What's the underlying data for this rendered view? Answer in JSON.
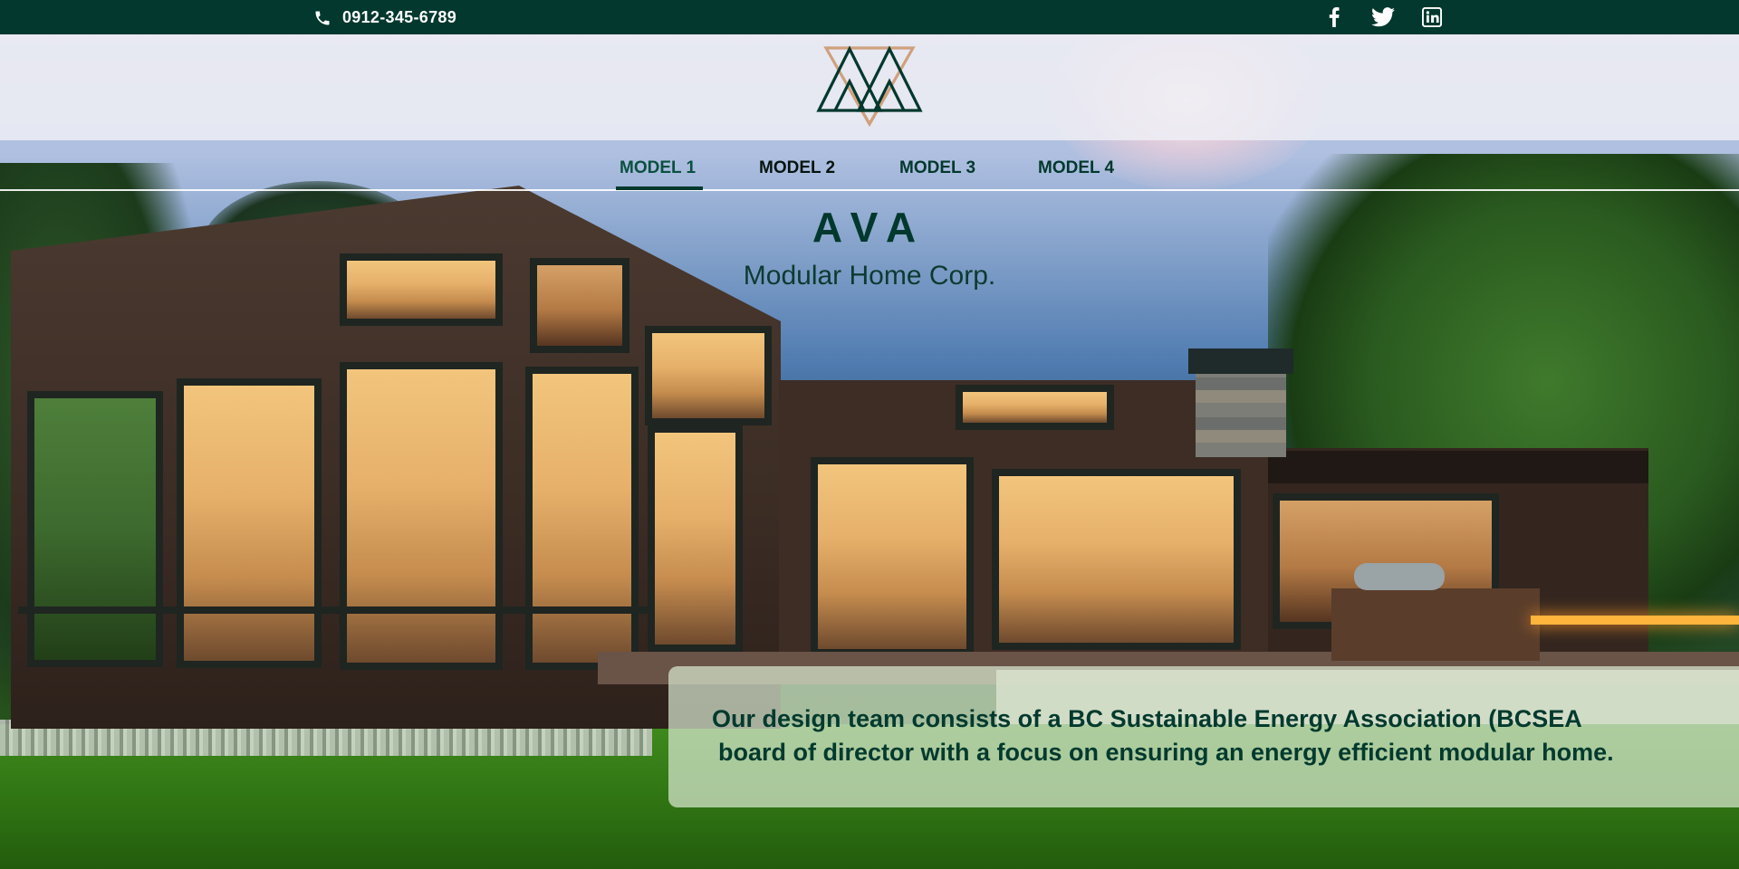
{
  "topbar": {
    "phone": "0912-345-6789",
    "icons": [
      "phone-icon",
      "facebook-icon",
      "twitter-icon",
      "linkedin-icon"
    ]
  },
  "logo": {
    "icon": "ava-triangle-logo",
    "colors": [
      "#02382d",
      "#d0a07c"
    ]
  },
  "nav": {
    "items": [
      {
        "label": "MODEL 1",
        "active": true
      },
      {
        "label": "MODEL 2",
        "active": false
      },
      {
        "label": "MODEL 3",
        "active": false
      },
      {
        "label": "MODEL 4",
        "active": false
      }
    ]
  },
  "brand": {
    "title": "AVA",
    "subtitle": "Modular Home Corp."
  },
  "info": {
    "line1": "Our design team consists of a BC Sustainable Energy Association (BCSEA",
    "line2": "board of director with a focus on ensuring an energy efficient modular home."
  },
  "colors": {
    "primary": "#02382d",
    "accent": "#d0a07c",
    "panel": "#d8e8d0"
  }
}
